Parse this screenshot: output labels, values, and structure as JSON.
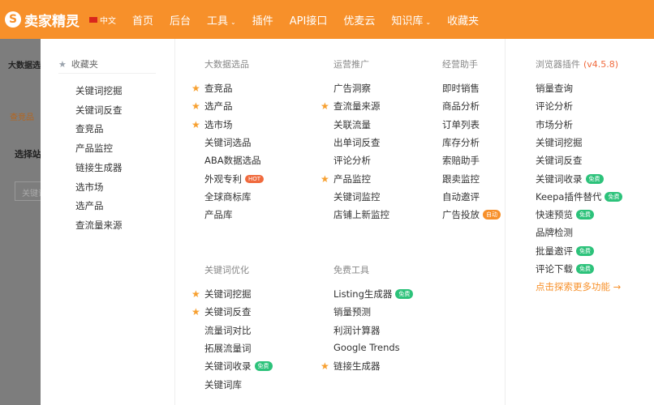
{
  "topbar": {
    "logo": "卖家精灵",
    "lang": "中文",
    "nav": [
      "首页",
      "后台",
      "工具",
      "插件",
      "API接口",
      "优麦云",
      "知识库",
      "收藏夹"
    ]
  },
  "background": {
    "t1": "大数据选品",
    "t2": "查竞品",
    "t3": "选择站点",
    "t4": "关键词"
  },
  "favorites": {
    "title": "收藏夹",
    "items": [
      "关键词挖掘",
      "关键词反查",
      "查竞品",
      "产品监控",
      "链接生成器",
      "选市场",
      "选产品",
      "查流量来源"
    ]
  },
  "columns": [
    {
      "title": "大数据选品",
      "items": [
        {
          "label": "查竞品",
          "star": true
        },
        {
          "label": "选产品",
          "star": true
        },
        {
          "label": "选市场",
          "star": true
        },
        {
          "label": "关键词选品"
        },
        {
          "label": "ABA数据选品"
        },
        {
          "label": "外观专利",
          "badge": "HOT"
        },
        {
          "label": "全球商标库"
        },
        {
          "label": "产品库"
        }
      ]
    },
    {
      "title": "运营推广",
      "items": [
        {
          "label": "广告洞察"
        },
        {
          "label": "查流量来源",
          "star": true
        },
        {
          "label": "关联流量"
        },
        {
          "label": "出单词反查"
        },
        {
          "label": "评论分析"
        },
        {
          "label": "产品监控",
          "star": true
        },
        {
          "label": "关键词监控"
        },
        {
          "label": "店铺上新监控"
        }
      ]
    },
    {
      "title": "经营助手",
      "items": [
        {
          "label": "即时销售"
        },
        {
          "label": "商品分析"
        },
        {
          "label": "订单列表"
        },
        {
          "label": "库存分析"
        },
        {
          "label": "索赔助手"
        },
        {
          "label": "跟卖监控"
        },
        {
          "label": "自动邀评"
        },
        {
          "label": "广告投放",
          "badge": "自动"
        }
      ]
    },
    {
      "title": "关键词优化",
      "items": [
        {
          "label": "关键词挖掘",
          "star": true
        },
        {
          "label": "关键词反查",
          "star": true
        },
        {
          "label": "流量词对比"
        },
        {
          "label": "拓展流量词"
        },
        {
          "label": "关键词收录",
          "badge": "免费"
        },
        {
          "label": "关键词库"
        }
      ]
    },
    {
      "title": "免费工具",
      "items": [
        {
          "label": "Listing生成器",
          "badge": "免费"
        },
        {
          "label": "销量预测"
        },
        {
          "label": "利润计算器"
        },
        {
          "label": "Google Trends"
        },
        {
          "label": "链接生成器",
          "star": true
        }
      ]
    }
  ],
  "plugin": {
    "title": "浏览器插件",
    "version": "(v4.5.8)",
    "items": [
      {
        "label": "销量查询"
      },
      {
        "label": "评论分析"
      },
      {
        "label": "市场分析"
      },
      {
        "label": "关键词挖掘"
      },
      {
        "label": "关键词反查"
      },
      {
        "label": "关键词收录",
        "badge": "免费"
      },
      {
        "label": "Keepa插件替代",
        "badge": "免费"
      },
      {
        "label": "快速预览",
        "badge": "免费"
      },
      {
        "label": "品牌检测"
      },
      {
        "label": "批量邀评",
        "badge": "免费"
      },
      {
        "label": "评论下载",
        "badge": "免费"
      }
    ],
    "more": "点击探索更多功能 →"
  },
  "colors": {
    "brand": "#f7902a",
    "free": "#2cc27a",
    "hot": "#f06a3d"
  }
}
